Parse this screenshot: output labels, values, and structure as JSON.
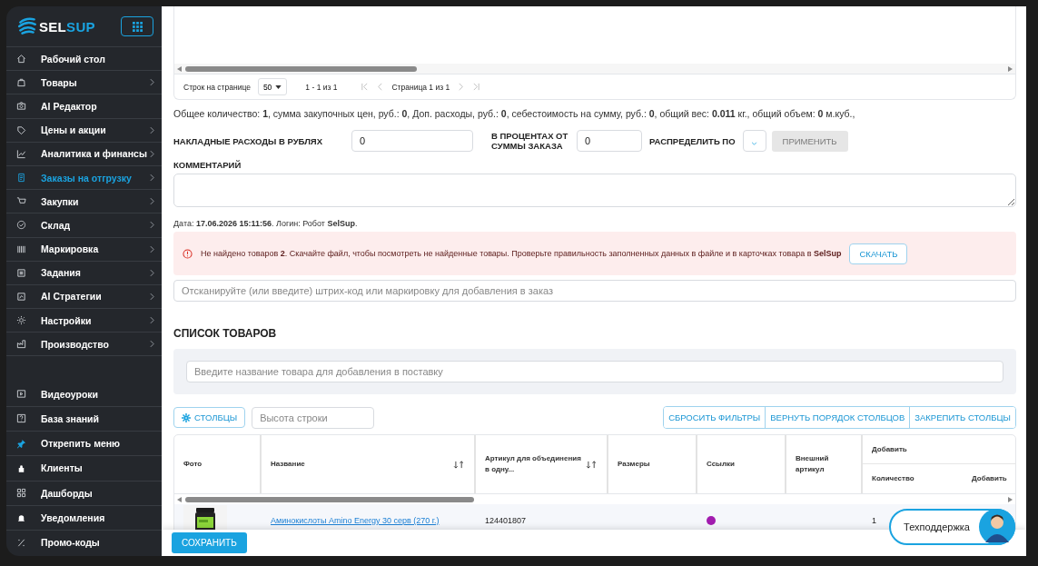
{
  "sidebar": {
    "logo": {
      "part_1": "SEL",
      "part_2": "SUP"
    },
    "menu": [
      {
        "label": "Рабочий стол",
        "expandable": false,
        "selected": false
      },
      {
        "label": "Товары",
        "expandable": true,
        "selected": false
      },
      {
        "label": "AI Редактор",
        "expandable": false,
        "selected": false
      },
      {
        "label": "Цены и акции",
        "expandable": true,
        "selected": false
      },
      {
        "label": "Аналитика и финансы",
        "expandable": true,
        "selected": false
      },
      {
        "label": "Заказы на отгрузку",
        "expandable": true,
        "selected": true
      },
      {
        "label": "Закупки",
        "expandable": true,
        "selected": false
      },
      {
        "label": "Склад",
        "expandable": true,
        "selected": false
      },
      {
        "label": "Маркировка",
        "expandable": true,
        "selected": false
      },
      {
        "label": "Задания",
        "expandable": true,
        "selected": false
      },
      {
        "label": "AI Стратегии",
        "expandable": true,
        "selected": false
      },
      {
        "label": "Настройки",
        "expandable": true,
        "selected": false
      },
      {
        "label": "Производство",
        "expandable": true,
        "selected": false
      }
    ],
    "footer": [
      {
        "label": "Видеоуроки"
      },
      {
        "label": "База знаний"
      },
      {
        "label": "Открепить меню"
      },
      {
        "label": "Клиенты"
      },
      {
        "label": "Дашборды"
      },
      {
        "label": "Уведомления"
      },
      {
        "label": "Промо-коды"
      }
    ]
  },
  "pagination": {
    "rows_label": "Строк на странице",
    "rows_per_page": "50",
    "range": "1 - 1 из 1",
    "page": "Страница 1 из 1"
  },
  "summary": "Общее количество: **1**, сумма закупочных цен, руб.: **0**, Доп. расходы, руб.: **0**, себестоимость на сумму, руб.: **0**, общий вес: **0.011** кг., общий объем: **0** м.куб.,",
  "overhead": {
    "label": "НАКЛАДНЫЕ РАСХОДЫ В РУБЛЯХ",
    "value": "0",
    "percent_label": "В ПРОЦЕНТАХ ОТ СУММЫ ЗАКАЗА",
    "percent_value": "0",
    "distribute_label": "РАСПРЕДЕЛИТЬ ПО",
    "apply": {
      "label": "ПРИМЕНИТЬ",
      "disabled": true
    }
  },
  "comment": {
    "label": "КОММЕНТАРИЙ"
  },
  "meta": "Дата: **17.06.2026 15:11:56**. Логин: Робот **SelSup**.",
  "alert": {
    "text": "Не найдено товаров **2**. Скачайте файл, чтобы посмотреть не найденные товары. Проверьте правильность заполненных данных в файле и в карточках товара в **SelSup**",
    "button": "СКАЧАТЬ"
  },
  "scan": {
    "placeholder": "Отсканируйте (или введите) штрих-код или маркировку для добавления в заказ"
  },
  "products": {
    "title": "СПИСОК ТОВАРОВ",
    "add_placeholder": "Введите название товара для добавления в поставку",
    "columns_button": "СТОЛБЦЫ",
    "row_height_placeholder": "Высота строки",
    "actions": [
      "СБРОСИТЬ ФИЛЬТРЫ",
      "ВЕРНУТЬ ПОРЯДОК СТОЛБЦОВ",
      "ЗАКРЕПИТЬ СТОЛБЦЫ"
    ],
    "columns": [
      {
        "label": "Фото",
        "sortable": false
      },
      {
        "label": "Название",
        "sortable": true
      },
      {
        "label": "Артикул для объединения в одну...",
        "sortable": true
      },
      {
        "label": "Размеры",
        "sortable": false
      },
      {
        "label": "Ссылки",
        "sortable": false
      },
      {
        "label": "Внешний артикул",
        "sortable": false
      }
    ],
    "group": {
      "label": "Добавить",
      "subcolumns": [
        "Количество",
        "Добавить"
      ]
    },
    "rows": [
      {
        "name": "Аминокислоты Amino Energy 30 серв (270 г.)",
        "article": "124401807",
        "quantity": "1"
      }
    ]
  },
  "save_button": "СОХРАНИТЬ",
  "support": "Техподдержка"
}
